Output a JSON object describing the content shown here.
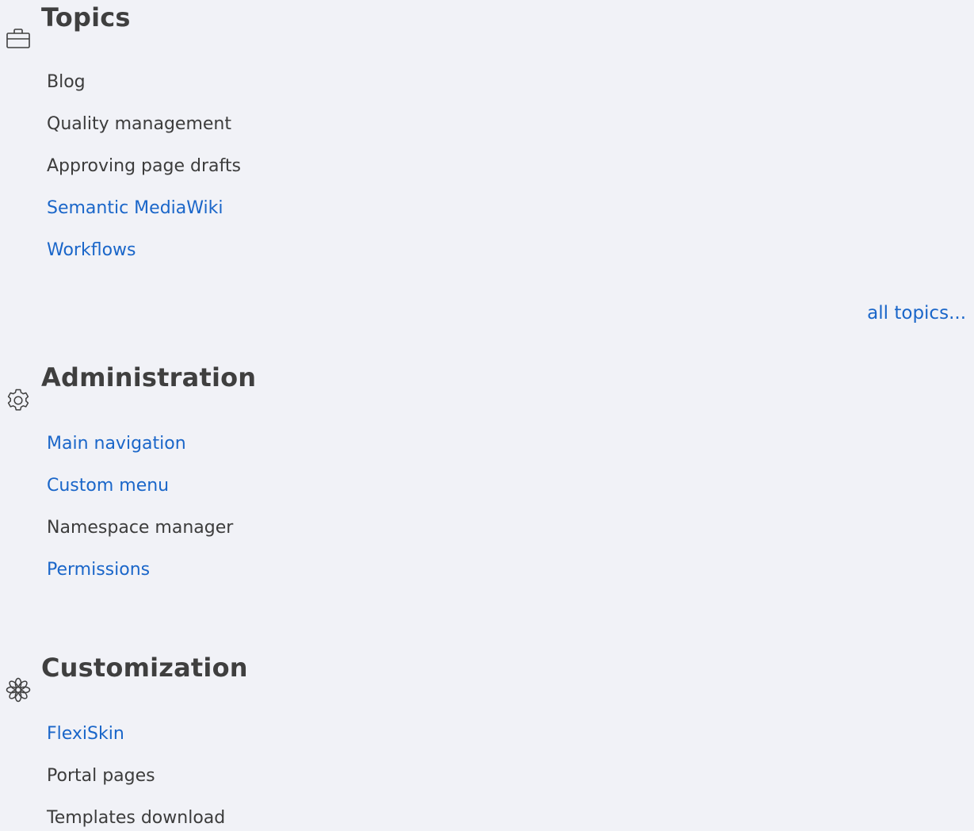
{
  "sections": [
    {
      "title": "Topics",
      "icon": "briefcase-icon",
      "items": [
        {
          "label": "Blog",
          "is_link": false
        },
        {
          "label": "Quality management",
          "is_link": false
        },
        {
          "label": "Approving page drafts",
          "is_link": false
        },
        {
          "label": "Semantic MediaWiki",
          "is_link": true
        },
        {
          "label": "Workflows",
          "is_link": true
        }
      ],
      "more_label": "all topics..."
    },
    {
      "title": "Administration",
      "icon": "gear-icon",
      "items": [
        {
          "label": "Main navigation",
          "is_link": true
        },
        {
          "label": "Custom menu",
          "is_link": true
        },
        {
          "label": "Namespace manager",
          "is_link": false
        },
        {
          "label": "Permissions",
          "is_link": true
        }
      ]
    },
    {
      "title": "Customization",
      "icon": "flower-icon",
      "items": [
        {
          "label": "FlexiSkin",
          "is_link": true
        },
        {
          "label": "Portal pages",
          "is_link": false
        },
        {
          "label": "Templates download",
          "is_link": false
        }
      ]
    }
  ],
  "colors": {
    "background": "#f1f2f7",
    "link": "#1a66c9",
    "text": "#3c3c3c",
    "heading": "#3f3f3f"
  }
}
